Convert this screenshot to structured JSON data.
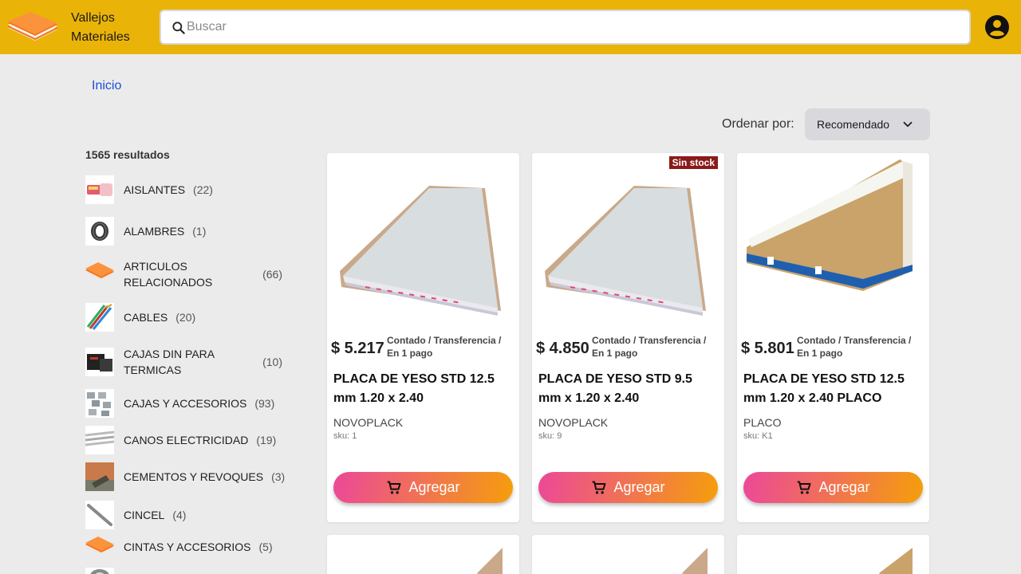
{
  "header": {
    "brand_line1": "Vallejos",
    "brand_line2": "Materiales",
    "search_placeholder": "Buscar",
    "accent_color": "#eab308"
  },
  "breadcrumb": "Inicio",
  "sort": {
    "label": "Ordenar por:",
    "value": "Recomendado"
  },
  "results_count": "1565 resultados",
  "categories": [
    {
      "name": "AISLANTES",
      "count": "(22)"
    },
    {
      "name": "ALAMBRES",
      "count": "(1)"
    },
    {
      "name": "ARTICULOS RELACIONADOS",
      "count": "(66)"
    },
    {
      "name": "CABLES",
      "count": "(20)"
    },
    {
      "name": "CAJAS DIN PARA TERMICAS",
      "count": "(10)"
    },
    {
      "name": "CAJAS Y ACCESORIOS",
      "count": "(93)"
    },
    {
      "name": "CANOS ELECTRICIDAD",
      "count": "(19)"
    },
    {
      "name": "CEMENTOS Y REVOQUES",
      "count": "(3)"
    },
    {
      "name": "CINCEL",
      "count": "(4)"
    },
    {
      "name": "CINTAS Y ACCESORIOS",
      "count": "(5)"
    }
  ],
  "products": [
    {
      "price": "$ 5.217",
      "terms": "Contado / Transferencia / En 1 pago",
      "name": "PLACA DE YESO STD 12.5 mm 1.20 x 2.40",
      "brand": "NOVOPLACK",
      "sku": "sku: 1",
      "badge": "",
      "button": "Agregar"
    },
    {
      "price": "$ 4.850",
      "terms": "Contado / Transferencia / En 1 pago",
      "name": "PLACA DE YESO STD 9.5 mm x 1.20 x 2.40",
      "brand": "NOVOPLACK",
      "sku": "sku: 9",
      "badge": "Sin stock",
      "button": "Agregar"
    },
    {
      "price": "$ 5.801",
      "terms": "Contado / Transferencia / En 1 pago",
      "name": "PLACA DE YESO STD 12.5 mm 1.20 x 2.40 PLACO",
      "brand": "PLACO",
      "sku": "sku: K1",
      "badge": "",
      "button": "Agregar"
    }
  ]
}
